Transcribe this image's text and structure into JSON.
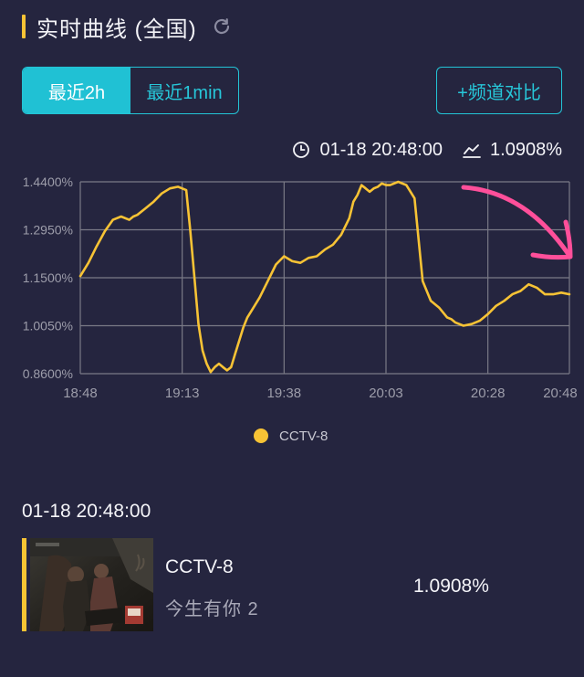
{
  "header": {
    "title": "实时曲线 (全国)"
  },
  "tabs": [
    {
      "label": "最近2h"
    },
    {
      "label": "最近1min"
    }
  ],
  "compare_button": {
    "label": "+频道对比"
  },
  "readout": {
    "time": "01-18 20:48:00",
    "value": "1.0908%"
  },
  "colors": {
    "background": "#25253f",
    "accent": "#20c1d4",
    "series": "#f7c335",
    "annotation": "#ff4f9a"
  },
  "chart_data": {
    "type": "line",
    "x_tick_labels": [
      "18:48",
      "19:13",
      "19:38",
      "20:03",
      "20:28",
      "20:48"
    ],
    "y_tick_labels": [
      "1.4400%",
      "1.2950%",
      "1.1500%",
      "1.0050%",
      "0.8600%"
    ],
    "ylim": [
      0.86,
      1.44
    ],
    "xlim_minutes": [
      0,
      120
    ],
    "grid": true,
    "legend_position": "bottom",
    "series": [
      {
        "name": "CCTV-8",
        "x_minutes": [
          0,
          2,
          4,
          6,
          8,
          10,
          12,
          13,
          14,
          16,
          18,
          20,
          22,
          24,
          26,
          27,
          28,
          29,
          30,
          31,
          32,
          33,
          34,
          35,
          36,
          37,
          38,
          39,
          40,
          41,
          42,
          44,
          46,
          48,
          50,
          52,
          54,
          56,
          58,
          60,
          62,
          64,
          66,
          67,
          68,
          69,
          70,
          71,
          72,
          73,
          74,
          75,
          76,
          77,
          78,
          80,
          82,
          84,
          86,
          88,
          90,
          91,
          92,
          93,
          94,
          96,
          98,
          100,
          102,
          104,
          106,
          108,
          110,
          112,
          114,
          116,
          118,
          120
        ],
        "values": [
          1.155,
          1.195,
          1.245,
          1.29,
          1.325,
          1.335,
          1.325,
          1.335,
          1.34,
          1.36,
          1.38,
          1.405,
          1.42,
          1.425,
          1.415,
          1.29,
          1.15,
          1.01,
          0.93,
          0.89,
          0.865,
          0.88,
          0.89,
          0.88,
          0.87,
          0.88,
          0.92,
          0.96,
          1.0,
          1.03,
          1.05,
          1.09,
          1.14,
          1.19,
          1.215,
          1.2,
          1.195,
          1.21,
          1.215,
          1.235,
          1.25,
          1.28,
          1.33,
          1.38,
          1.4,
          1.43,
          1.42,
          1.41,
          1.42,
          1.425,
          1.435,
          1.43,
          1.43,
          1.435,
          1.44,
          1.43,
          1.39,
          1.14,
          1.08,
          1.06,
          1.03,
          1.025,
          1.015,
          1.01,
          1.005,
          1.01,
          1.02,
          1.04,
          1.065,
          1.08,
          1.1,
          1.11,
          1.13,
          1.12,
          1.1,
          1.1,
          1.105,
          1.1
        ]
      }
    ]
  },
  "legend": {
    "label": "CCTV-8"
  },
  "detail": {
    "time": "01-18 20:48:00",
    "channel": "CCTV-8",
    "program": "今生有你 2",
    "value": "1.0908%"
  },
  "icons": {
    "refresh": "refresh-icon",
    "clock": "clock-icon",
    "trend": "trend-icon"
  }
}
